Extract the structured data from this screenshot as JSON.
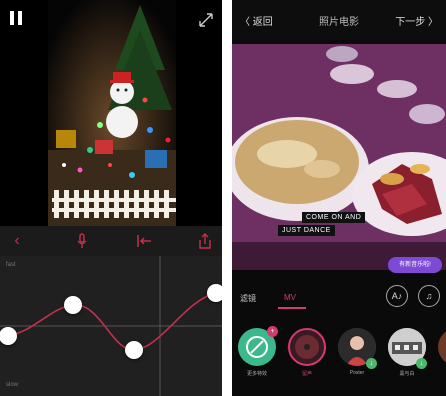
{
  "left": {
    "graph": {
      "top_label": "fast",
      "bottom_label": "slow"
    },
    "icons": {
      "pause": "pause-icon",
      "expand": "expand-icon",
      "back": "chevron-left-icon",
      "mic": "microphone-icon",
      "trim": "trim-icon",
      "share": "share-icon"
    }
  },
  "right": {
    "topbar": {
      "back_label": "〈 返回",
      "title": "照片电影",
      "next_label": "下一步 〉"
    },
    "captions": {
      "line1": "COME ON AND",
      "line2": "JUST DANCE"
    },
    "hint_bubble": "有新音乐啦!",
    "tabs": [
      {
        "label": "滤镜"
      },
      {
        "label": "MV"
      }
    ],
    "buttons": {
      "text_icon": "text-style-icon",
      "music_icon": "music-note-icon"
    },
    "items": [
      {
        "name": "更多特效"
      },
      {
        "name": "留声"
      },
      {
        "name": "Poster"
      },
      {
        "name": "黑与白"
      }
    ],
    "colors": {
      "accent": "#d33b6f",
      "bubble": "#7d4ad6",
      "green": "#4db86d"
    }
  }
}
